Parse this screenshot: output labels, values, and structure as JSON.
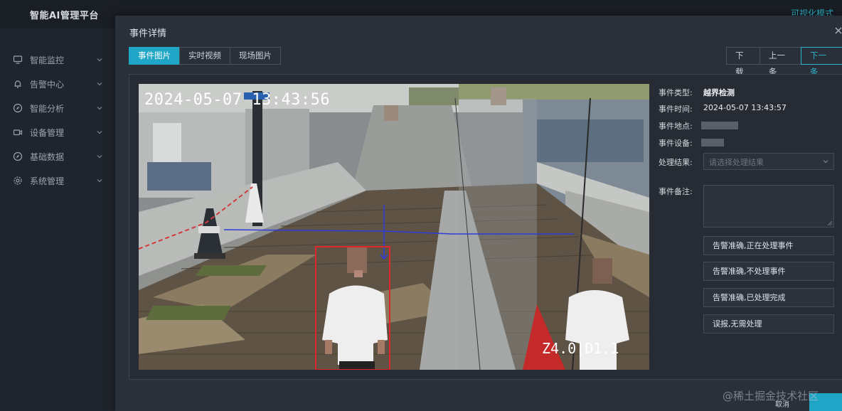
{
  "app": {
    "title": "智能AI管理平台",
    "top_right_link": "可视化模式"
  },
  "sidebar": {
    "items": [
      {
        "label": "智能监控",
        "icon": "monitor-icon"
      },
      {
        "label": "告警中心",
        "icon": "bell-icon"
      },
      {
        "label": "智能分析",
        "icon": "compass-icon"
      },
      {
        "label": "设备管理",
        "icon": "camera-icon"
      },
      {
        "label": "基础数据",
        "icon": "compass-icon"
      },
      {
        "label": "系统管理",
        "icon": "gear-icon"
      }
    ]
  },
  "modal": {
    "title": "事件详情",
    "tabs": [
      {
        "label": "事件图片",
        "active": true
      },
      {
        "label": "实时视频",
        "active": false
      },
      {
        "label": "现场图片",
        "active": false
      }
    ],
    "nav": {
      "download": "下载",
      "prev": "上一条",
      "next": "下一条"
    },
    "image": {
      "timestamp": "2024-05-07 13:43:56",
      "zoom": "Z4.0|D1.1"
    },
    "details": {
      "type_label": "事件类型:",
      "type_value": "越界检测",
      "time_label": "事件时间:",
      "time_value": "2024-05-07 13:43:57",
      "location_label": "事件地点:",
      "device_label": "事件设备:",
      "result_label": "处理结果:",
      "result_placeholder": "请选择处理结果",
      "remark_label": "事件备注:"
    },
    "actions": [
      "告警准确,正在处理事件",
      "告警准确,不处理事件",
      "告警准确,已处理完成",
      "误报,无需处理"
    ]
  },
  "footer": {
    "cancel": "取消",
    "watermark": "@稀土掘金技术社区"
  },
  "colors": {
    "accent": "#1fa6c7",
    "detection_box": "#e0262b",
    "tripwire": "#2f3bdc"
  }
}
